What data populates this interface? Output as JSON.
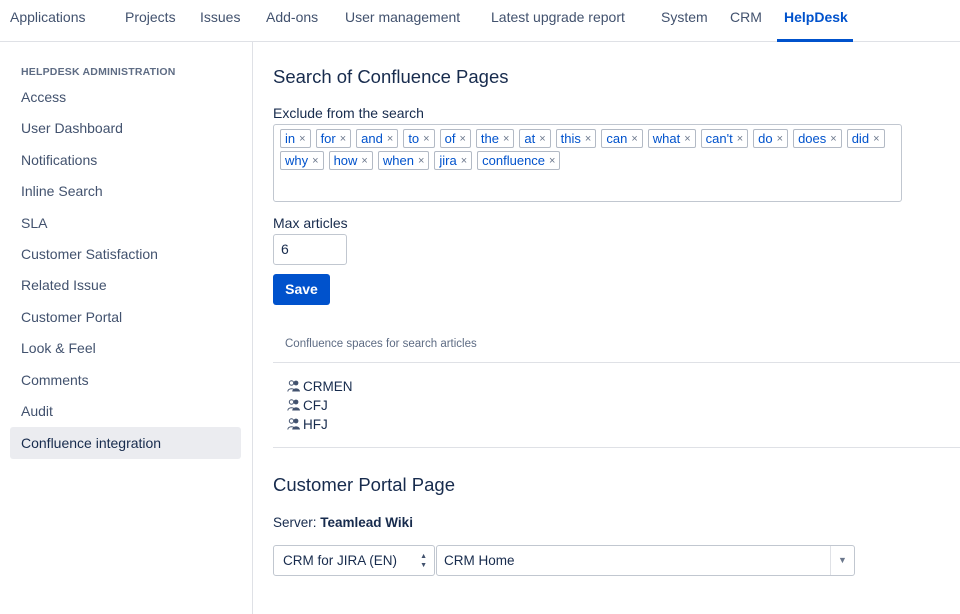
{
  "topnav": {
    "items": [
      "Applications",
      "Projects",
      "Issues",
      "Add-ons",
      "User management",
      "Latest upgrade report",
      "System",
      "CRM",
      "HelpDesk"
    ],
    "active": "HelpDesk"
  },
  "sidebar": {
    "heading": "HELPDESK ADMINISTRATION",
    "items": [
      "Access",
      "User Dashboard",
      "Notifications",
      "Inline Search",
      "SLA",
      "Customer Satisfaction",
      "Related Issue",
      "Customer Portal",
      "Look & Feel",
      "Comments",
      "Audit",
      "Confluence integration"
    ],
    "active": "Confluence integration"
  },
  "search_section": {
    "title": "Search of Confluence Pages",
    "exclude_label": "Exclude from the search",
    "tags": [
      "in",
      "for",
      "and",
      "to",
      "of",
      "the",
      "at",
      "this",
      "can",
      "what",
      "can't",
      "do",
      "does",
      "did",
      "why",
      "how",
      "when",
      "jira",
      "confluence"
    ],
    "tag_remove_glyph": "×",
    "max_label": "Max articles",
    "max_value": "6",
    "save_label": "Save"
  },
  "spaces": {
    "header": "Confluence spaces for search articles",
    "icon": "group-icon",
    "items": [
      "CRMEN",
      "CFJ",
      "HFJ"
    ]
  },
  "portal_section": {
    "title": "Customer Portal Page",
    "server_label": "Server:",
    "server_value": "Teamlead Wiki",
    "space_select": "CRM for JIRA (EN)",
    "page_select": "CRM Home"
  },
  "colors": {
    "accent": "#0052cc",
    "text": "#172b4d",
    "muted": "#42526e",
    "active_bg": "#ebecf0"
  }
}
